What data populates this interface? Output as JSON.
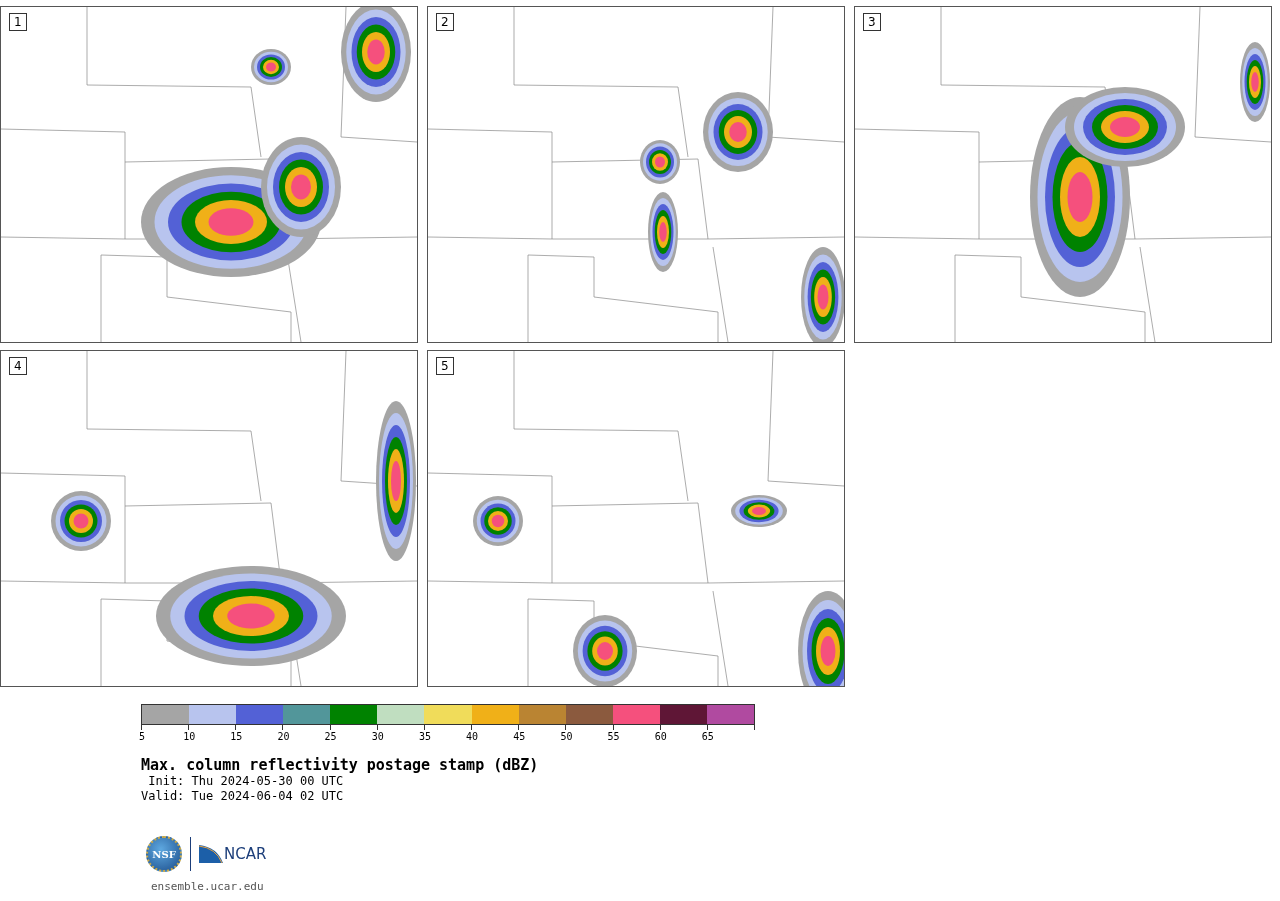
{
  "panels": [
    {
      "label": "1"
    },
    {
      "label": "2"
    },
    {
      "label": "3"
    },
    {
      "label": "4"
    },
    {
      "label": "5"
    }
  ],
  "colorbar": [
    {
      "label": "5",
      "color": "#a5a5a5"
    },
    {
      "label": "10",
      "color": "#b8c4ee"
    },
    {
      "label": "15",
      "color": "#5361d6"
    },
    {
      "label": "20",
      "color": "#52969a"
    },
    {
      "label": "25",
      "color": "#008200"
    },
    {
      "label": "30",
      "color": "#c0dec0"
    },
    {
      "label": "35",
      "color": "#f0dc5a"
    },
    {
      "label": "40",
      "color": "#f0b018"
    },
    {
      "label": "45",
      "color": "#ba8432"
    },
    {
      "label": "50",
      "color": "#8b5a3e"
    },
    {
      "label": "55",
      "color": "#f5507d"
    },
    {
      "label": "60",
      "color": "#5f1636"
    },
    {
      "label": "65",
      "color": "#b04aa0"
    }
  ],
  "title": "Max. column reflectivity postage stamp (dBZ)",
  "init": " Init: Thu 2024-05-30 00 UTC",
  "valid": "Valid: Tue 2024-06-04 02 UTC",
  "logos": {
    "nsf": "NSF",
    "ncar": "NCAR"
  },
  "footer_link": "ensemble.ucar.edu"
}
